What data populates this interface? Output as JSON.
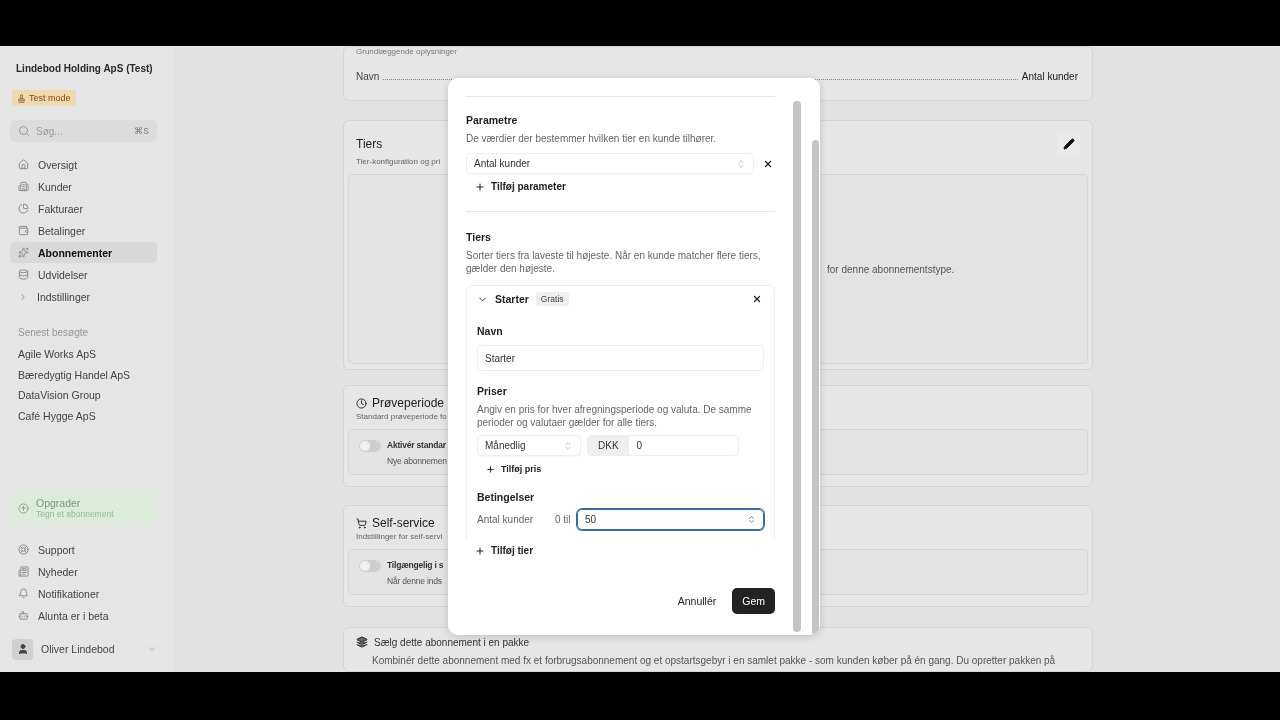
{
  "sidebar": {
    "org": "Lindebod Holding ApS (Test)",
    "badge": "Test mode",
    "search": {
      "placeholder": "Søg...",
      "shortcut": "⌘S"
    },
    "nav": [
      {
        "label": "Oversigt",
        "selected": false
      },
      {
        "label": "Kunder",
        "selected": false
      },
      {
        "label": "Fakturaer",
        "selected": false
      },
      {
        "label": "Betalinger",
        "selected": false
      },
      {
        "label": "Abonnementer",
        "selected": true
      },
      {
        "label": "Udvidelser",
        "selected": false
      },
      {
        "label": "Indstillinger",
        "selected": false
      }
    ],
    "recent_heading": "Senest besøgte",
    "recent": [
      "Agile Works ApS",
      "Bæredygtig Handel ApS",
      "DataVision Group",
      "Café Hygge ApS"
    ],
    "upgrade": {
      "title": "Opgrader",
      "subtitle": "Tegn et abonnement"
    },
    "footer_links": [
      "Support",
      "Nyheder",
      "Notifikationer",
      "Alunta er i beta"
    ],
    "user": {
      "name": "Oliver Lindebod"
    }
  },
  "page": {
    "basics": {
      "heading": "Grundlæggende oplysninger",
      "label": "Navn",
      "value": "Antal kunder"
    },
    "tiers": {
      "title": "Tiers",
      "subtitle": "Tier-konfiguration og pri",
      "note": "for denne abonnementstype."
    },
    "trial": {
      "title": "Prøveperiode",
      "subtitle": "Standard prøveperiode fo",
      "toggle_label": "Aktivér standar",
      "toggle_on": false,
      "description": "Nye abonnemen"
    },
    "self_service": {
      "title": "Self-service",
      "subtitle": "Indstillinger for self-servi",
      "toggle_label": "Tilgængelig i s",
      "toggle_on": false,
      "description": "Når denne inds"
    },
    "bundle": {
      "title": "Sælg dette abonnement i en pakke",
      "text": "Kombinér dette abonnement med fx et forbrugsabonnement og et opstartsgebyr i en samlet pakke - som kunden køber på én gang. Du opretter pakken på"
    }
  },
  "dialog": {
    "parameters": {
      "title": "Parametre",
      "description": "De værdier der bestemmer hvilken tier en kunde tilhører.",
      "items": [
        "Antal kunder"
      ],
      "add": "Tilføj parameter"
    },
    "tiers": {
      "title": "Tiers",
      "description": "Sorter tiers fra laveste til højeste. Når en kunde matcher flere tiers, gælder den højeste.",
      "items": [
        {
          "name": "Starter",
          "badge": "Gratis",
          "expanded": true,
          "name_label": "Navn",
          "name_value": "Starter",
          "prices_label": "Priser",
          "prices_description": "Angiv en pris for hver afregningsperiode og valuta. De samme perioder og valutaer gælder for alle tiers.",
          "prices": [
            {
              "period": "Månedlig",
              "currency": "DKK",
              "amount": "0"
            }
          ],
          "add_price": "Tilføj pris",
          "conditions_label": "Betingelser",
          "conditions": [
            {
              "parameter": "Antal kunder",
              "from": "0 til",
              "to": "50",
              "focused": true
            }
          ]
        }
      ],
      "add": "Tilføj tier"
    },
    "cancel": "Annullér",
    "save": "Gem"
  }
}
